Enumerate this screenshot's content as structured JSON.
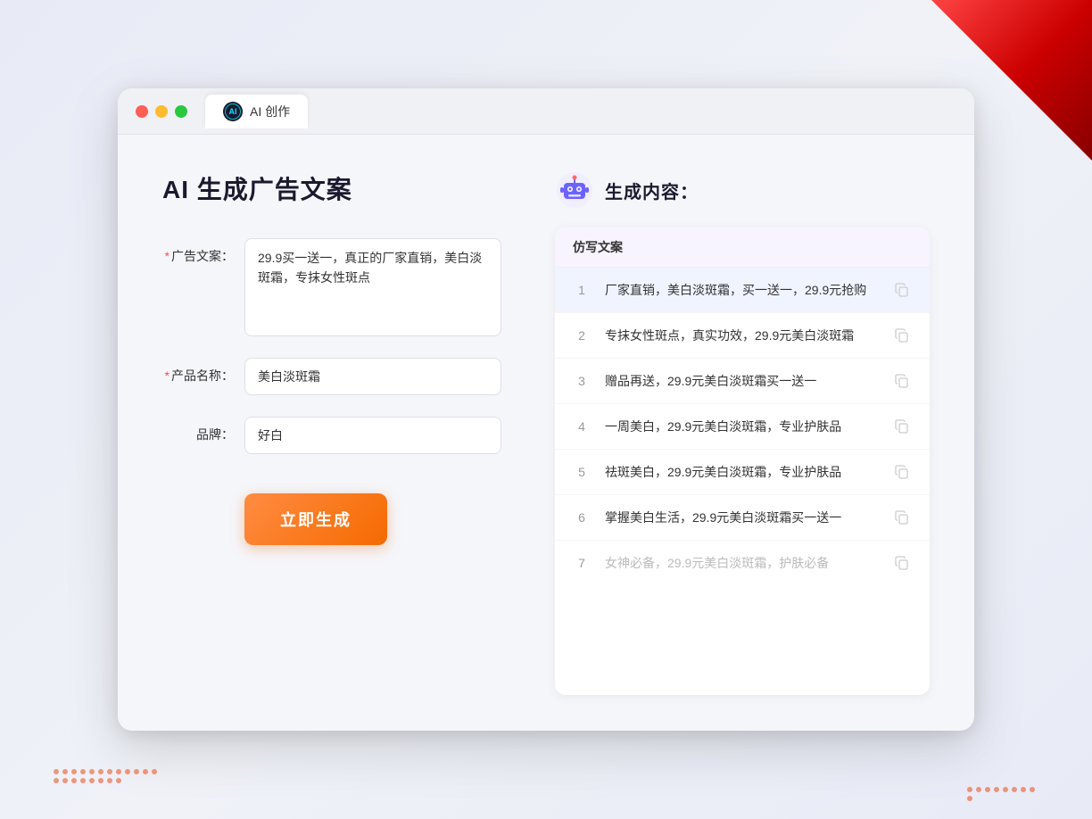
{
  "window": {
    "tab_label": "AI 创作",
    "tab_icon_text": "AI"
  },
  "left_panel": {
    "title": "AI 生成广告文案",
    "form": {
      "ad_copy_label": "广告文案：",
      "ad_copy_required": "*",
      "ad_copy_value": "29.9买一送一，真正的厂家直销，美白淡斑霜，专抹女性斑点",
      "product_name_label": "产品名称：",
      "product_name_required": "*",
      "product_name_value": "美白淡斑霜",
      "brand_label": "品牌：",
      "brand_value": "好白"
    },
    "generate_button": "立即生成"
  },
  "right_panel": {
    "title": "生成内容：",
    "table_header": "仿写文案",
    "results": [
      {
        "num": "1",
        "text": "厂家直销，美白淡斑霜，买一送一，29.9元抢购",
        "faded": false
      },
      {
        "num": "2",
        "text": "专抹女性斑点，真实功效，29.9元美白淡斑霜",
        "faded": false
      },
      {
        "num": "3",
        "text": "赠品再送，29.9元美白淡斑霜买一送一",
        "faded": false
      },
      {
        "num": "4",
        "text": "一周美白，29.9元美白淡斑霜，专业护肤品",
        "faded": false
      },
      {
        "num": "5",
        "text": "祛斑美白，29.9元美白淡斑霜，专业护肤品",
        "faded": false
      },
      {
        "num": "6",
        "text": "掌握美白生活，29.9元美白淡斑霜买一送一",
        "faded": false
      },
      {
        "num": "7",
        "text": "女神必备，29.9元美白淡斑霜，护肤必备",
        "faded": true
      }
    ]
  },
  "icons": {
    "copy": "copy-icon",
    "robot": "robot-icon",
    "ai_logo": "ai-logo-icon"
  }
}
